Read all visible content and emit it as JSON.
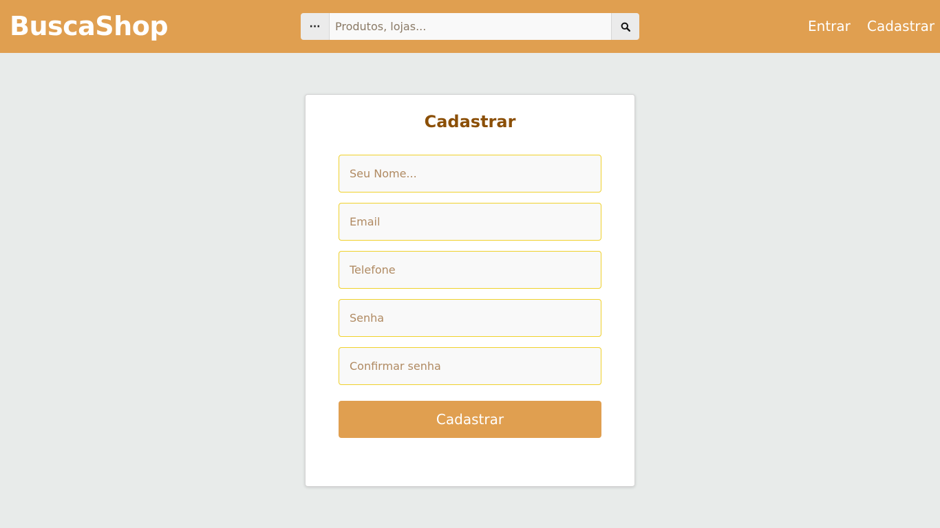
{
  "app": {
    "brand": "BuscaShop"
  },
  "header": {
    "menu_label": "···",
    "search_placeholder": "Produtos, lojas...",
    "login_label": "Entrar",
    "signup_label": "Cadastrar"
  },
  "form": {
    "title": "Cadastrar",
    "fields": [
      {
        "placeholder": "Seu Nome...",
        "value": ""
      },
      {
        "placeholder": "Email",
        "value": ""
      },
      {
        "placeholder": "Telefone",
        "value": ""
      },
      {
        "placeholder": "Senha",
        "value": ""
      },
      {
        "placeholder": "Confirmar senha",
        "value": ""
      }
    ],
    "submit_label": "Cadastrar"
  },
  "icons": {
    "search": "search-icon",
    "menu": "ellipsis-icon"
  },
  "colors": {
    "primary": "#e09f50",
    "title": "#8b4f06",
    "field_border": "#f0d12a",
    "background": "#e8ebea"
  }
}
